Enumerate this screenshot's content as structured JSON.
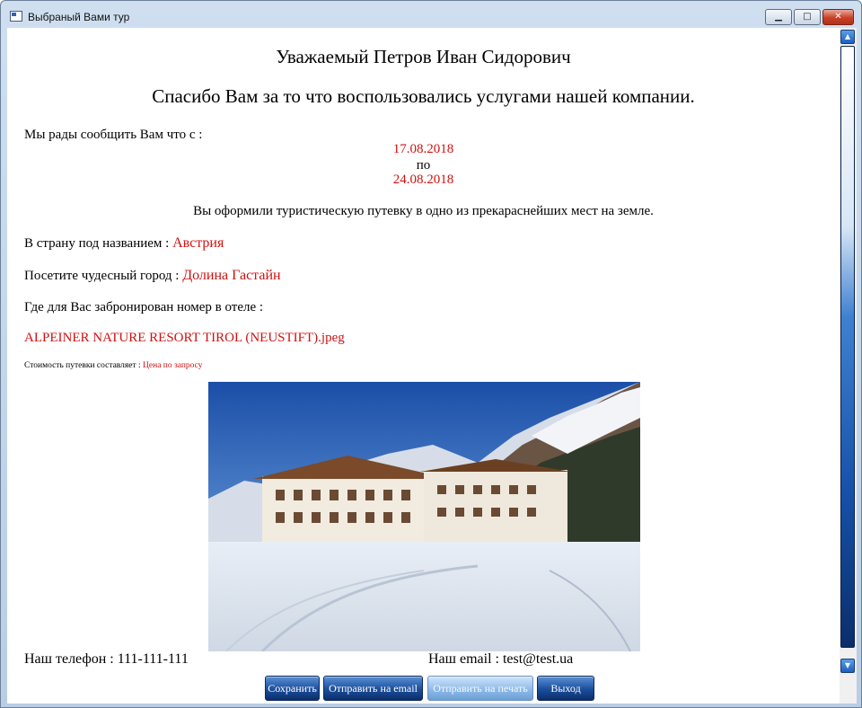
{
  "window": {
    "title": "Выбраный Вами тур",
    "minimize_glyph": "▁",
    "maximize_glyph": "□",
    "close_glyph": "✕"
  },
  "letter": {
    "greeting": "Уважаемый Петров Иван Сидорович",
    "thanks": "Спасибо Вам за то что воспользовались услугами нашей компании.",
    "intro": "Мы рады сообщить Вам что с :",
    "date_from": "17.08.2018",
    "date_sep": "по",
    "date_to": "24.08.2018",
    "booked_text": "Вы оформили туристическую путевку в одно из прекараснейших мест на земле.",
    "country_label": "В страну под названием :",
    "country_value": "Австрия",
    "city_label": "Посетите чудесный город :",
    "city_value": "Долина Гастайн",
    "hotel_label": "Где для Вас забронирован номер в отеле :",
    "hotel_value": "ALPEINER NATURE RESORT TIROL (NEUSTIFT).jpeg",
    "price_label": "Стоимость путевки составляет :",
    "price_value": "Цена по запросу",
    "phone": "Наш телефон : 111-111-111",
    "email": "Наш email : test@test.ua"
  },
  "buttons": {
    "save": "Сохранить",
    "send_email": "Отправить на email",
    "print": "Отправить на печать",
    "exit": "Выход"
  },
  "colors": {
    "accent_red": "#d01010",
    "button_blue": "#1b4e9b"
  }
}
